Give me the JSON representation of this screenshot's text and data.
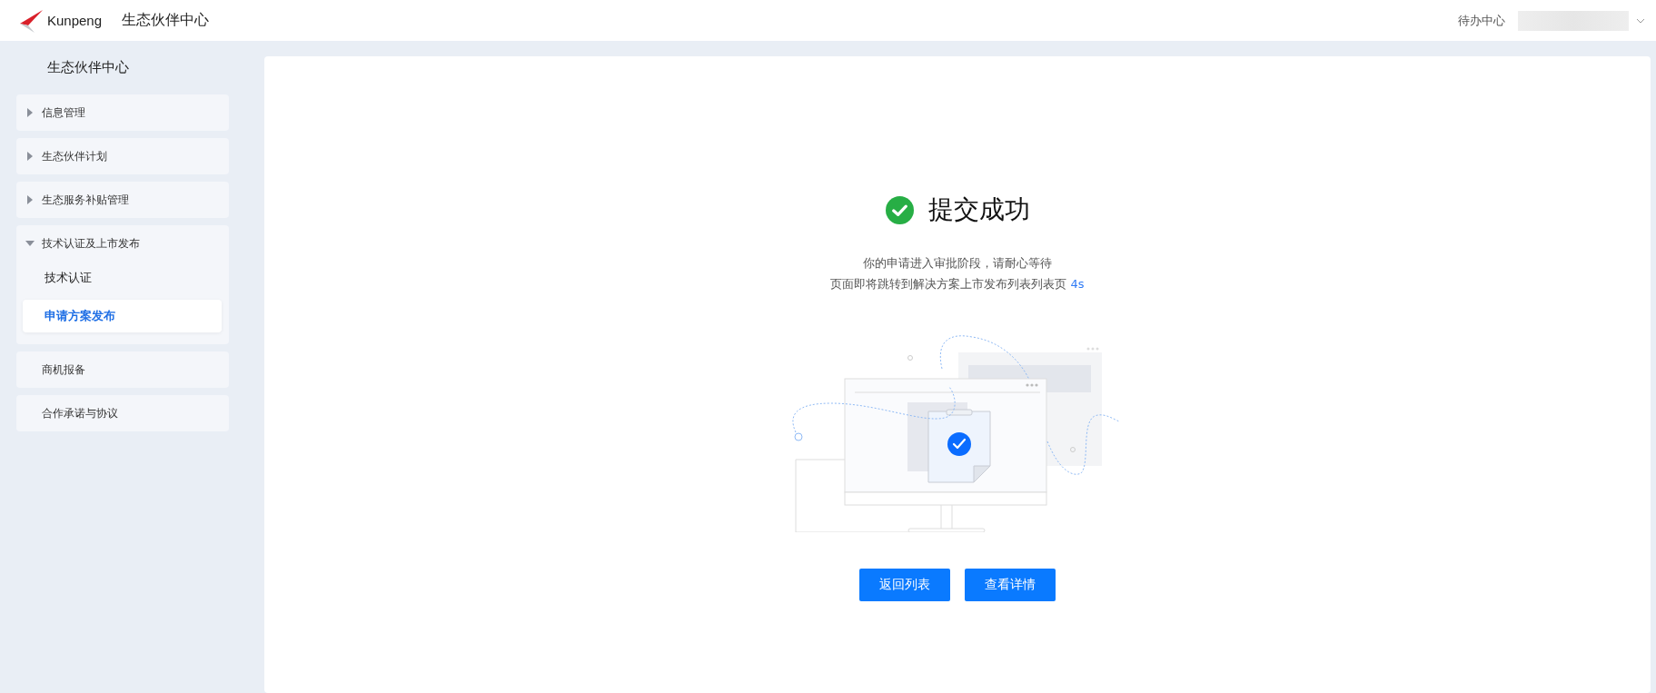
{
  "header": {
    "logo_text": "Kunpeng",
    "title": "生态伙伴中心",
    "todo_link": "待办中心"
  },
  "sidebar": {
    "title": "生态伙伴中心",
    "items": [
      {
        "label": "信息管理",
        "kind": "group",
        "expanded": false
      },
      {
        "label": "生态伙伴计划",
        "kind": "group",
        "expanded": false
      },
      {
        "label": "生态服务补贴管理",
        "kind": "group",
        "expanded": false
      },
      {
        "label": "技术认证及上市发布",
        "kind": "group",
        "expanded": true,
        "children": [
          {
            "label": "技术认证",
            "selected": false
          },
          {
            "label": "申请方案发布",
            "selected": true
          }
        ]
      },
      {
        "label": "商机报备",
        "kind": "link"
      },
      {
        "label": "合作承诺与协议",
        "kind": "link"
      }
    ]
  },
  "result": {
    "title": "提交成功",
    "message": "你的申请进入审批阶段，请耐心等待",
    "redirect_text": "页面即将跳转到解决方案上市发布列表列表页",
    "countdown": "4s",
    "buttons": [
      "返回列表",
      "查看详情"
    ]
  }
}
